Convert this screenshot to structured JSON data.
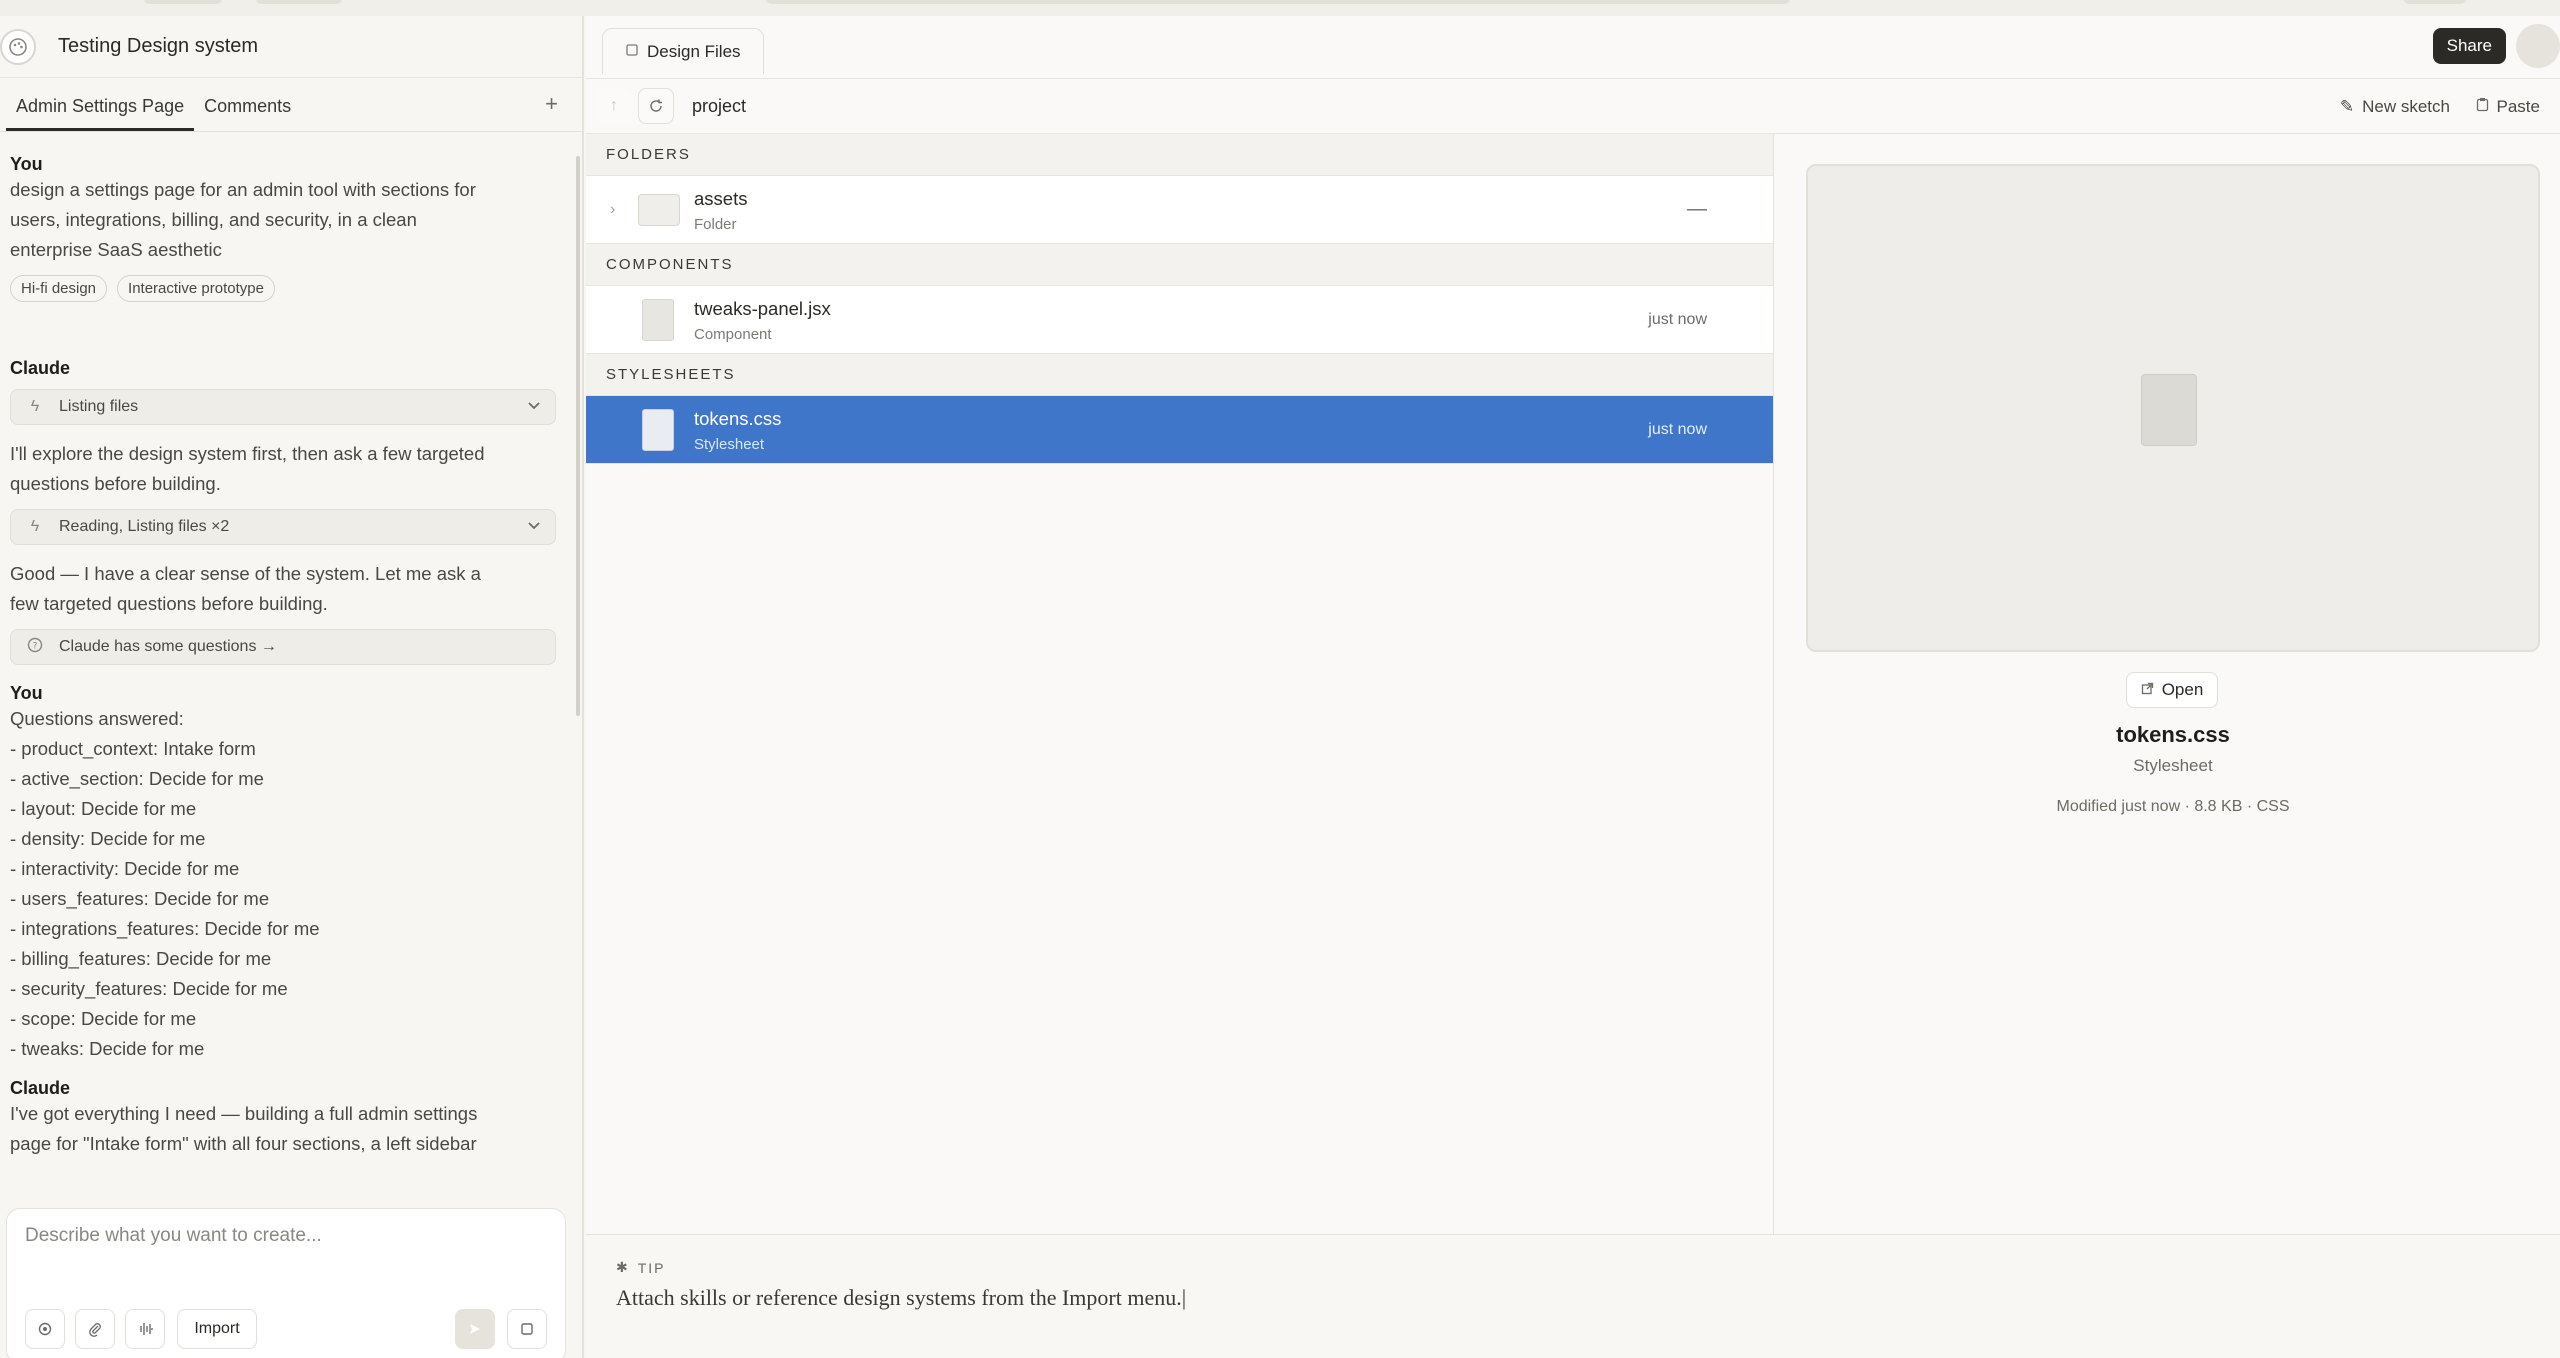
{
  "project": {
    "title": "Testing Design system"
  },
  "left_tabs": [
    "Admin Settings Page",
    "Comments"
  ],
  "chat": {
    "user1": {
      "speaker": "You",
      "lines": [
        "design a settings page for an admin tool with sections for",
        "users, integrations, billing, and security, in a clean",
        "enterprise SaaS aesthetic"
      ],
      "chips": [
        "Hi-fi design",
        "Interactive prototype"
      ]
    },
    "assistant1": {
      "speaker": "Claude",
      "tool1": "Listing files",
      "msg1": [
        "I'll explore the design system first, then ask a few targeted",
        "questions before building."
      ],
      "tool2": "Reading, Listing files ×2",
      "msg2": [
        "Good — I have a clear sense of the system. Let me ask a",
        "few targeted questions before building."
      ],
      "questions_link": "Claude has some questions →"
    },
    "user2": {
      "speaker": "You",
      "lines": [
        "Questions answered:",
        "- product_context: Intake form",
        "- active_section: Decide for me",
        "- layout: Decide for me",
        "- density: Decide for me",
        "- interactivity: Decide for me",
        "- users_features: Decide for me",
        "- integrations_features: Decide for me",
        "- billing_features: Decide for me",
        "- security_features: Decide for me",
        "- scope: Decide for me",
        "- tweaks: Decide for me"
      ]
    },
    "assistant2": {
      "speaker": "Claude",
      "lines": [
        "I've got everything I need — building a full admin settings",
        "page for \"Intake form\" with all four sections, a left sidebar"
      ]
    }
  },
  "composer": {
    "placeholder": "Describe what you want to create...",
    "import_label": "Import"
  },
  "main": {
    "tab_label": "Design Files",
    "share_label": "Share",
    "path": "project",
    "new_sketch": "New sketch",
    "paste": "Paste"
  },
  "sections": {
    "folders": "FOLDERS",
    "components": "COMPONENTS",
    "stylesheets": "STYLESHEETS"
  },
  "files": {
    "folder": {
      "name": "assets",
      "kind": "Folder",
      "status": "—"
    },
    "component": {
      "name": "tweaks-panel.jsx",
      "kind": "Component",
      "time": "just now"
    },
    "stylesheet": {
      "name": "tokens.css",
      "kind": "Stylesheet",
      "time": "just now"
    }
  },
  "preview": {
    "open_label": "Open",
    "name": "tokens.css",
    "kind": "Stylesheet",
    "meta": "Modified just now · 8.8 KB · CSS"
  },
  "tip": {
    "label": "TIP",
    "text": "Attach skills or reference design systems from the Import menu.|"
  },
  "colors": {
    "selected_row": "#3f76c9",
    "share_bg": "#2b2a27"
  },
  "icons": [
    "palette-icon",
    "plus-icon",
    "bolt-icon",
    "chevron-down-icon",
    "question-icon",
    "settings-icon",
    "paperclip-icon",
    "waveform-icon",
    "send-icon",
    "stop-icon",
    "doc-icon",
    "arrow-up-icon",
    "refresh-icon",
    "pen-icon",
    "clipboard-icon",
    "chevron-right-icon",
    "external-link-icon",
    "sparkle-icon"
  ]
}
